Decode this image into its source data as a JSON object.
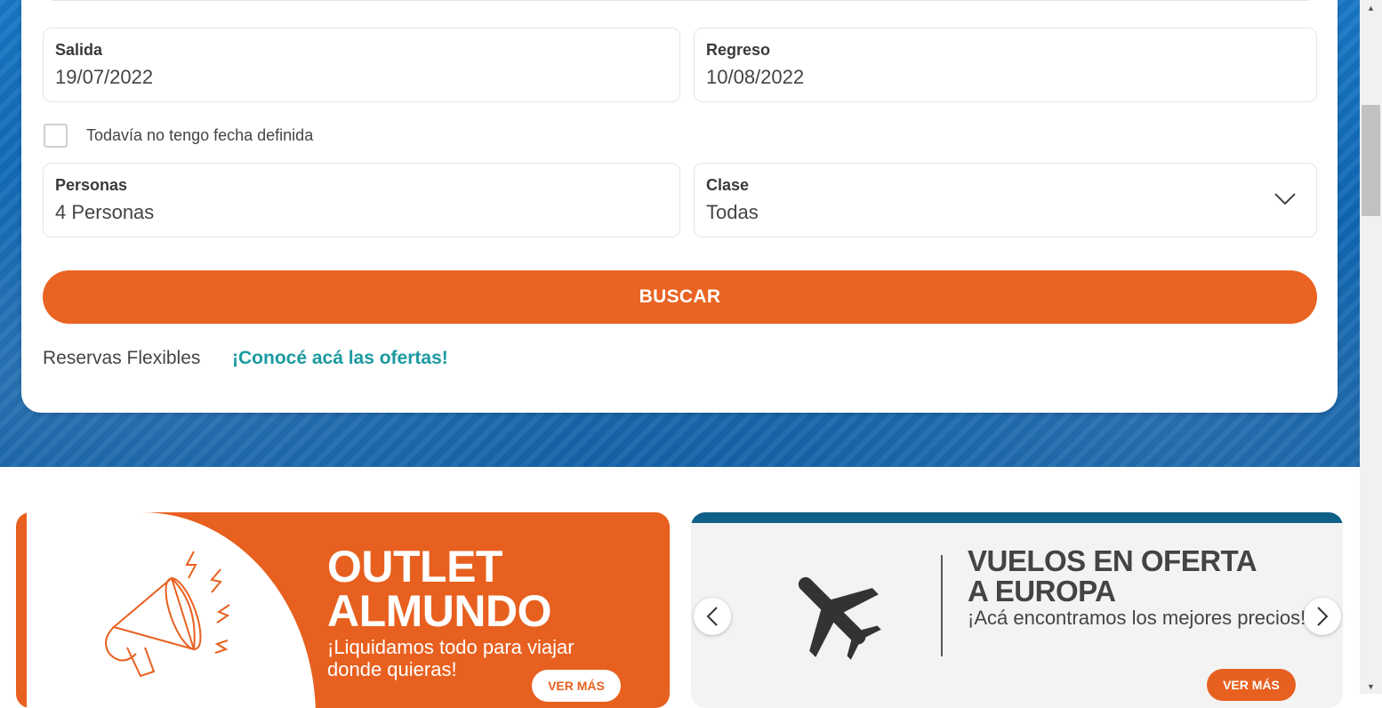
{
  "search": {
    "departure": {
      "label": "Salida",
      "value": "19/07/2022"
    },
    "return": {
      "label": "Regreso",
      "value": "10/08/2022"
    },
    "no_date_label": "Todavía no tengo fecha definida",
    "persons": {
      "label": "Personas",
      "value": "4 Personas"
    },
    "class": {
      "label": "Clase",
      "value": "Todas"
    },
    "search_button": "BUSCAR",
    "flexible_text": "Reservas Flexibles",
    "flexible_link": "¡Conocé acá las ofertas!"
  },
  "banners": {
    "outlet": {
      "title_line1": "OUTLET",
      "title_line2": "ALMUNDO",
      "subtitle": "¡Liquidamos todo para viajar donde quieras!",
      "cta": "VER MÁS"
    },
    "europa": {
      "title_line1": "VUELOS EN OFERTA",
      "title_line2": "A EUROPA",
      "subtitle": "¡Acá encontramos los mejores precios!",
      "cta": "VER MÁS"
    }
  },
  "colors": {
    "accent_orange": "#e96322",
    "link_teal": "#1b9aa0",
    "hero_blue": "#1168b4"
  },
  "icons": [
    "chevron-down-icon",
    "megaphone-icon",
    "airplane-icon",
    "chevron-left-icon",
    "chevron-right-icon"
  ]
}
